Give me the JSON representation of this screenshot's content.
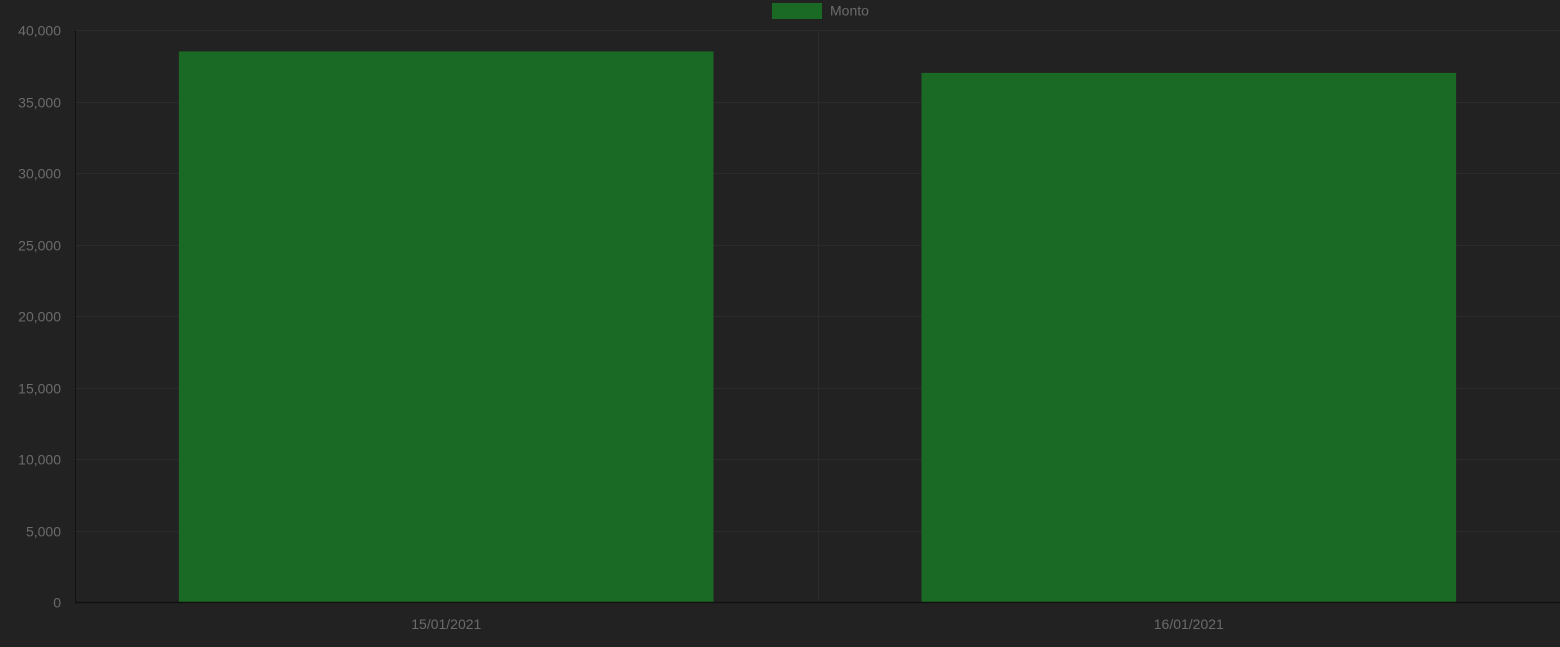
{
  "chart_data": {
    "type": "bar",
    "categories": [
      "15/01/2021",
      "16/01/2021"
    ],
    "series": [
      {
        "name": "Monto",
        "values": [
          38500,
          37000
        ],
        "color": "#1a6924"
      }
    ],
    "ylim": [
      0,
      40000
    ],
    "y_ticks": [
      {
        "value": 0,
        "label": "0"
      },
      {
        "value": 5000,
        "label": "5,000"
      },
      {
        "value": 10000,
        "label": "10,000"
      },
      {
        "value": 15000,
        "label": "15,000"
      },
      {
        "value": 20000,
        "label": "20,000"
      },
      {
        "value": 25000,
        "label": "25,000"
      },
      {
        "value": 30000,
        "label": "30,000"
      },
      {
        "value": 35000,
        "label": "35,000"
      },
      {
        "value": 40000,
        "label": "40,000"
      }
    ],
    "grid": true,
    "legend_position": "top-center",
    "colors": {
      "background": "#222222",
      "grid": "#2c2c2c",
      "axis": "#111111",
      "text": "#6b6b6b"
    }
  }
}
